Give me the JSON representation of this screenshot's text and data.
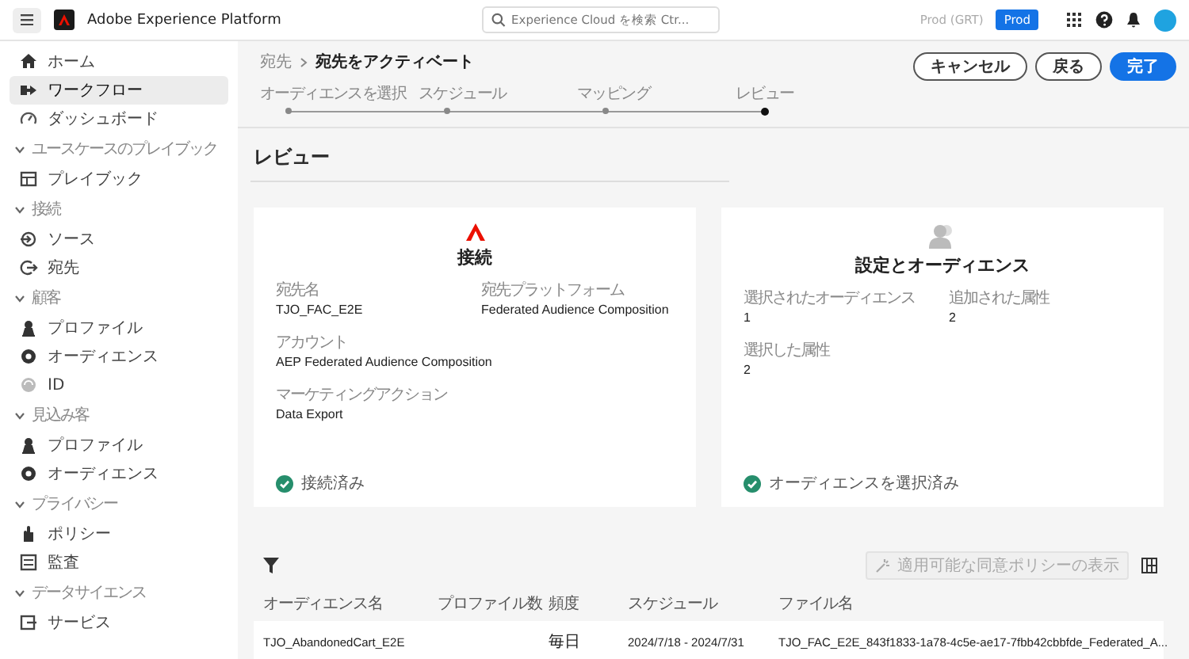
{
  "topbar": {
    "product": "Adobe Experience Platform",
    "search": {
      "placeholder": "Experience Cloud を検索 Ctr..."
    },
    "org": "Prod (GRT)",
    "sandbox": "Prod"
  },
  "sidebar": {
    "items": [
      {
        "kind": "item",
        "label": "ホーム",
        "selected": false
      },
      {
        "kind": "item",
        "label": "ワークフロー",
        "selected": true
      },
      {
        "kind": "item",
        "label": "ダッシュボード",
        "selected": false
      },
      {
        "kind": "section",
        "label": "ユースケースのプレイブック",
        "expanded": true
      },
      {
        "kind": "item",
        "label": "プレイブック",
        "selected": false
      },
      {
        "kind": "section",
        "label": "接続",
        "expanded": true
      },
      {
        "kind": "item",
        "label": "ソース",
        "selected": false
      },
      {
        "kind": "item",
        "label": "宛先",
        "selected": false
      },
      {
        "kind": "section",
        "label": "顧客",
        "expanded": true
      },
      {
        "kind": "item",
        "label": "プロファイル",
        "selected": false
      },
      {
        "kind": "item",
        "label": "オーディエンス",
        "selected": false
      },
      {
        "kind": "item",
        "label": "ID",
        "selected": false
      },
      {
        "kind": "section",
        "label": "見込み客",
        "expanded": true
      },
      {
        "kind": "item",
        "label": "プロファイル",
        "selected": false
      },
      {
        "kind": "item",
        "label": "オーディエンス",
        "selected": false
      },
      {
        "kind": "section",
        "label": "プライバシー",
        "expanded": true
      },
      {
        "kind": "item",
        "label": "ポリシー",
        "selected": false
      },
      {
        "kind": "item",
        "label": "監査",
        "selected": false
      },
      {
        "kind": "section",
        "label": "データサイエンス",
        "expanded": true
      },
      {
        "kind": "item",
        "label": "サービス",
        "selected": false
      }
    ]
  },
  "breadcrumbs": [
    "宛先",
    "宛先をアクティベート"
  ],
  "steps": [
    {
      "label": "オーディエンスを選択",
      "selected": false
    },
    {
      "label": "スケジュール",
      "selected": false
    },
    {
      "label": "マッピング",
      "selected": false
    },
    {
      "label": "レビュー",
      "selected": true
    }
  ],
  "buttons": [
    "キャンセル",
    "戻る",
    "完了"
  ],
  "heading": "レビュー",
  "cards": [
    {
      "kind": "connection",
      "title": "接続",
      "fields": [
        {
          "label": "宛先名",
          "value": "TJO_FAC_E2E"
        },
        {
          "label": "宛先プラットフォーム",
          "value": "Federated Audience Composition"
        },
        {
          "label": "アカウント",
          "value": "AEP Federated Audience Composition"
        },
        {
          "label": "マーケティングアクション",
          "value": "Data Export"
        }
      ],
      "status": "接続済み"
    },
    {
      "kind": "audience",
      "title": "設定とオーディエンス",
      "fields": [
        {
          "label": "選択されたオーディエンス",
          "value": "1"
        },
        {
          "label": "追加された属性",
          "value": "2"
        },
        {
          "label": "選択した属性",
          "value": "2"
        }
      ],
      "status": "オーディエンスを選択済み"
    }
  ],
  "table": {
    "policy_button": {
      "label": "適用可能な同意ポリシーの表示",
      "disabled": true
    },
    "columns": [
      "オーディエンス名",
      "プロファイル数",
      "頻度",
      "スケジュール",
      "ファイル名"
    ],
    "rows": [
      {
        "audience_name": "TJO_AbandonedCart_E2E",
        "frequency": "毎日",
        "schedule": "2024/7/18 - 2024/7/31",
        "file_name": "TJO_FAC_E2E_843f1833-1a78-4c5e-ae17-7fbb42cbbfde_Federated_A..."
      }
    ]
  }
}
